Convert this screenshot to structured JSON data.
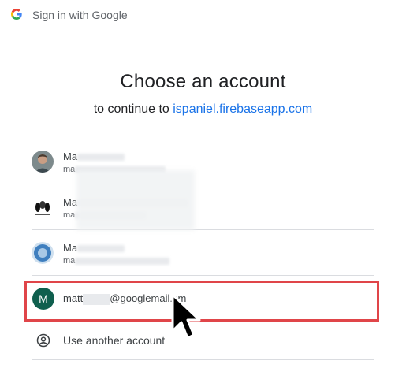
{
  "header": {
    "text": "Sign in with Google",
    "logo_icon": "google-g-icon"
  },
  "title": "Choose an account",
  "subtitle": {
    "prefix": "to continue to ",
    "link": "ispaniel.firebaseapp.com"
  },
  "accounts": [
    {
      "name": "Ma",
      "email": "ma",
      "avatar": "photo-avatar"
    },
    {
      "name": "Ma",
      "email": "ma",
      "avatar": "spaniel-logo-avatar"
    },
    {
      "name": "Ma",
      "email": "ma",
      "avatar": "blue-crest-avatar"
    }
  ],
  "selected_account": {
    "initial": "M",
    "email_start": "matt",
    "email_end": "@googlemail.c",
    "email_tail": "m",
    "avatar_color": "#0f5f4e"
  },
  "use_another": {
    "label": "Use another account",
    "icon": "person-circle-icon"
  },
  "colors": {
    "link": "#1a73e8",
    "highlight": "#e04549",
    "divider": "#dadce0"
  }
}
